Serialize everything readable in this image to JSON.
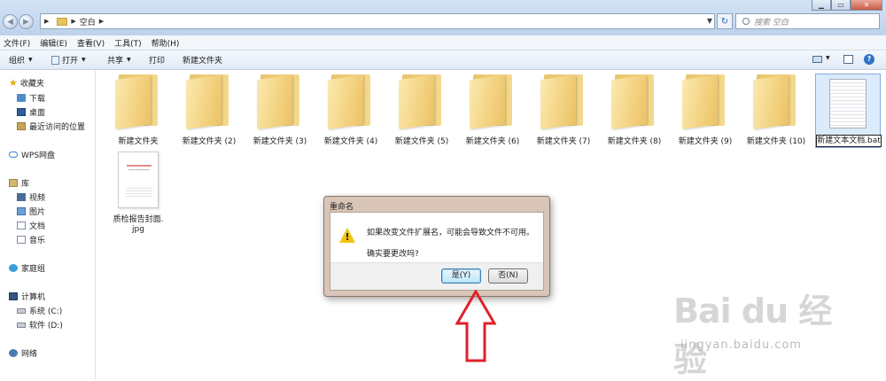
{
  "address": {
    "path": "空白"
  },
  "search": {
    "placeholder": "搜索 空白"
  },
  "menu": [
    "文件(F)",
    "编辑(E)",
    "查看(V)",
    "工具(T)",
    "帮助(H)"
  ],
  "commands": {
    "organize": "组织",
    "open": "打开",
    "share": "共享",
    "print": "打印",
    "new_folder": "新建文件夹"
  },
  "nav": {
    "favorites": "收藏夹",
    "favorites_items": [
      "下载",
      "桌面",
      "最近访问的位置"
    ],
    "wps": "WPS网盘",
    "library": "库",
    "library_items": [
      "视频",
      "图片",
      "文档",
      "音乐"
    ],
    "homegroup": "家庭组",
    "computer": "计算机",
    "computer_items": [
      "系统 (C:)",
      "软件 (D:)"
    ],
    "network": "网络"
  },
  "files": {
    "folders": [
      "新建文件夹",
      "新建文件夹 (2)",
      "新建文件夹 (3)",
      "新建文件夹 (4)",
      "新建文件夹 (5)",
      "新建文件夹 (6)",
      "新建文件夹 (7)",
      "新建文件夹 (8)",
      "新建文件夹 (9)",
      "新建文件夹 (10)"
    ],
    "bat_name": "新建文本文档.bat",
    "jpg_name_line1": "质检报告封面.",
    "jpg_name_line2": "jpg"
  },
  "dialog": {
    "title": "重命名",
    "message": "如果改变文件扩展名，可能会导致文件不可用。",
    "question": "确实要更改吗?",
    "yes": "是(Y)",
    "no": "否(N)"
  },
  "watermark": {
    "logo": "Bai du 经验",
    "url": "jingyan.baidu.com"
  },
  "colors": {
    "dialog_frame": "#d9c5b8",
    "arrow": "#e0202a",
    "folder": "#f3d27f",
    "titlebar": "#c8dbf1"
  }
}
